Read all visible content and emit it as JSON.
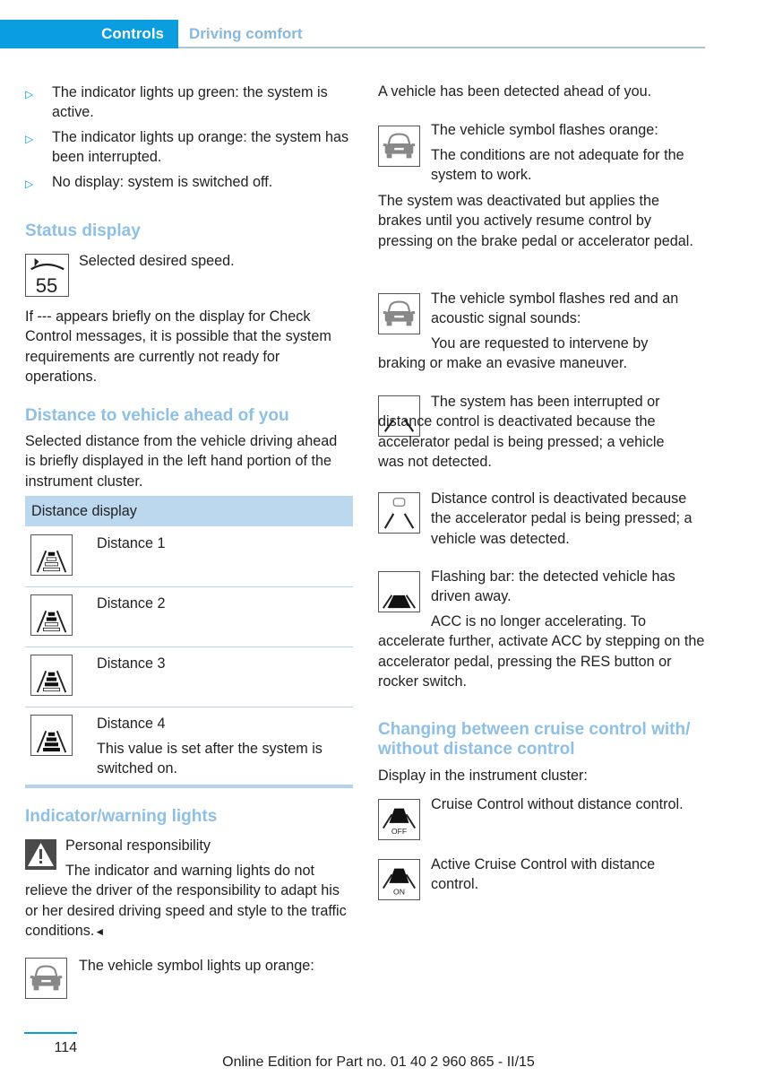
{
  "header": {
    "section": "Controls",
    "chapter": "Driving comfort"
  },
  "left_column": {
    "bullets": [
      "The indicator lights up green: the system is active.",
      "The indicator lights up orange: the system has been interrupted.",
      "No display: system is switched off."
    ],
    "status_display": {
      "heading": "Status display",
      "icon_value": "55",
      "icon_caption": "Selected desired speed.",
      "paragraph": "If --- appears briefly on the display for Check Control messages, it is possible that the system requirements are currently not ready for operations."
    },
    "distance": {
      "heading": "Distance to vehicle ahead of you",
      "paragraph": "Selected distance from the vehicle driving ahead is briefly displayed in the left hand portion of the instrument cluster.",
      "table": {
        "header": "Distance display",
        "rows": [
          {
            "label": "Distance 1",
            "note": "",
            "filled_bars": 1
          },
          {
            "label": "Distance 2",
            "note": "",
            "filled_bars": 2
          },
          {
            "label": "Distance 3",
            "note": "",
            "filled_bars": 3
          },
          {
            "label": "Distance 4",
            "note": "This value is set after the system is switched on.",
            "filled_bars": 4
          }
        ]
      }
    },
    "indicator": {
      "heading": "Indicator/warning lights",
      "warning_title": "Personal responsibility",
      "warning_text": "The indicator and warning lights do not relieve the driver of the responsibility to adapt his or her desired driving speed and style to the traffic conditions.",
      "end_mark": "◄",
      "vehicle_orange": "The vehicle symbol lights up orange:"
    }
  },
  "right_column": {
    "intro": "A vehicle has been detected ahead of you.",
    "flash_orange_title": "The vehicle symbol flashes orange:",
    "flash_orange_text": "The conditions are not adequate for the system to work.",
    "deactivated_text": "The system was deactivated but applies the brakes until you actively resume control by pressing on the brake pedal or accelerator pedal.",
    "flash_red_title": "The vehicle symbol flashes red and an acoustic signal sounds:",
    "flash_red_text": "You are requested to intervene by braking or make an evasive maneuver.",
    "interrupted_text": "The system has been interrupted or distance control is deactivated because the accelerator pedal is being pressed; a vehicle was not detected.",
    "deactivated_detected_text": "Distance control is deactivated because the accelerator pedal is being pressed; a vehicle was detected.",
    "flashing_bar_title": "Flashing bar: the detected vehicle has driven away.",
    "flashing_bar_text": "ACC is no longer accelerating. To accelerate further, activate ACC by stepping on the accelerator pedal, pressing the RES button or rocker switch.",
    "changing": {
      "heading": "Changing between cruise control with/ without distance control",
      "intro": "Display in the instrument cluster:",
      "off_label": "OFF",
      "off_text": "Cruise Control without distance control.",
      "on_label": "ON",
      "on_text": "Active Cruise Control with distance control."
    }
  },
  "footer": {
    "page_number": "114",
    "edition": "Online Edition for Part no. 01 40 2 960 865 - II/15"
  },
  "colors": {
    "accent_blue": "#0a9ddf",
    "heading_blue": "#8ec0e6",
    "table_header_bg": "#bcd8ee"
  }
}
